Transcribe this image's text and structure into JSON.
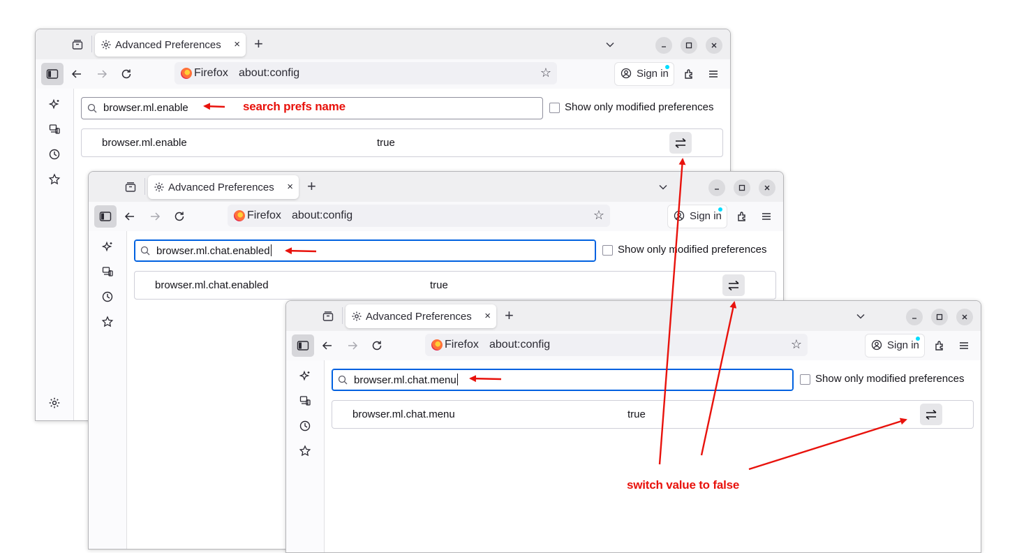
{
  "windows": [
    {
      "tab_title": "Advanced Preferences",
      "tab_close": "×",
      "new_tab": "+",
      "url_identity": "Firefox",
      "url": "about:config",
      "signin_label": "Sign in",
      "search_value": "browser.ml.enable",
      "show_modified_label": "Show only modified preferences",
      "pref_name": "browser.ml.enable",
      "pref_value": "true"
    },
    {
      "tab_title": "Advanced Preferences",
      "tab_close": "×",
      "new_tab": "+",
      "url_identity": "Firefox",
      "url": "about:config",
      "signin_label": "Sign in",
      "search_value": "browser.ml.chat.enabled",
      "show_modified_label": "Show only modified preferences",
      "pref_name": "browser.ml.chat.enabled",
      "pref_value": "true"
    },
    {
      "tab_title": "Advanced Preferences",
      "tab_close": "×",
      "new_tab": "+",
      "url_identity": "Firefox",
      "url": "about:config",
      "signin_label": "Sign in",
      "search_value": "browser.ml.chat.menu",
      "show_modified_label": "Show only modified preferences",
      "pref_name": "browser.ml.chat.menu",
      "pref_value": "true"
    }
  ],
  "annotations": {
    "search_label": "search prefs name",
    "switch_label": "switch value to false"
  },
  "colors": {
    "annotation": "#e8120c",
    "focus_ring": "#0061e0"
  },
  "icons": [
    "tab-groups-icon",
    "gear-icon",
    "chevron-down-icon",
    "minimize-icon",
    "maximize-icon",
    "close-icon",
    "sidebar-icon",
    "back-arrow-icon",
    "forward-arrow-icon",
    "reload-icon",
    "firefox-logo-icon",
    "bookmark-star-icon",
    "account-icon",
    "extensions-icon",
    "menu-icon",
    "ai-sparkle-icon",
    "synced-tabs-icon",
    "history-icon",
    "bookmarks-icon",
    "search-icon",
    "toggle-arrows-icon"
  ]
}
